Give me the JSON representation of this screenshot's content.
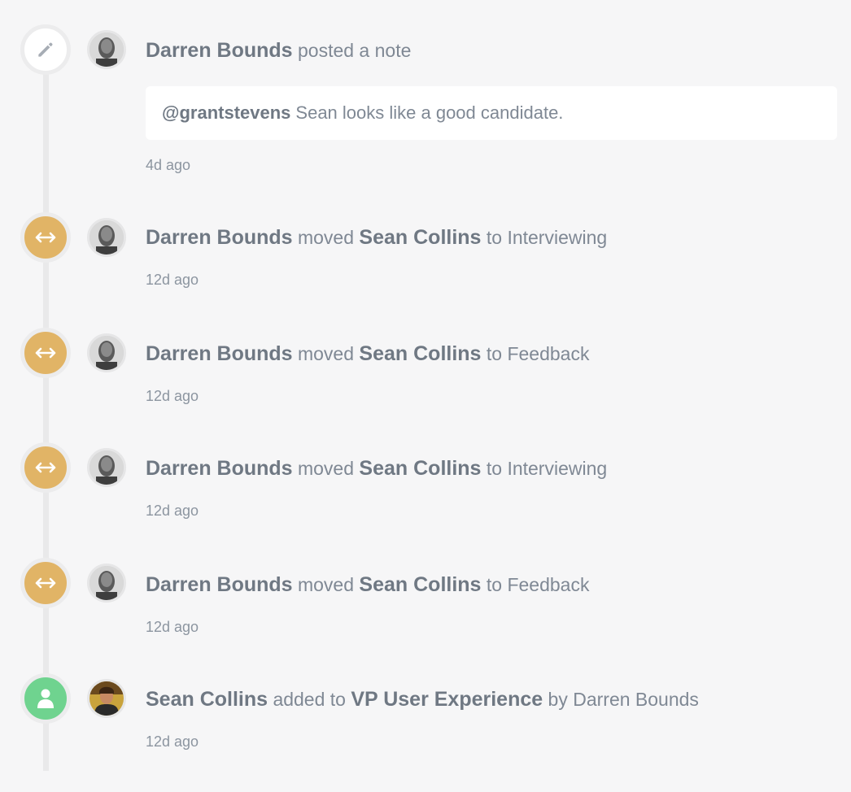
{
  "colors": {
    "move_marker": "#e1b466",
    "add_marker": "#6fd38f",
    "note_marker": "#ffffff",
    "rail": "#e9e9ea"
  },
  "events": [
    {
      "type": "note",
      "icon": "pencil-icon",
      "actor": "Darren Bounds",
      "action": "posted a note",
      "note_mention": "@grantstevens",
      "note_text": "Sean looks like a good candidate.",
      "time": "4d ago"
    },
    {
      "type": "move",
      "icon": "arrows-horizontal-icon",
      "actor": "Darren Bounds",
      "action": "moved",
      "subject": "Sean Collins",
      "preposition": "to",
      "target": "Interviewing",
      "time": "12d ago"
    },
    {
      "type": "move",
      "icon": "arrows-horizontal-icon",
      "actor": "Darren Bounds",
      "action": "moved",
      "subject": "Sean Collins",
      "preposition": "to",
      "target": "Feedback",
      "time": "12d ago"
    },
    {
      "type": "move",
      "icon": "arrows-horizontal-icon",
      "actor": "Darren Bounds",
      "action": "moved",
      "subject": "Sean Collins",
      "preposition": "to",
      "target": "Interviewing",
      "time": "12d ago"
    },
    {
      "type": "move",
      "icon": "arrows-horizontal-icon",
      "actor": "Darren Bounds",
      "action": "moved",
      "subject": "Sean Collins",
      "preposition": "to",
      "target": "Feedback",
      "time": "12d ago"
    },
    {
      "type": "add",
      "icon": "person-icon",
      "actor": "Sean Collins",
      "action": "added to",
      "job": "VP User Experience",
      "by_label": "by Darren Bounds",
      "time": "12d ago"
    }
  ]
}
